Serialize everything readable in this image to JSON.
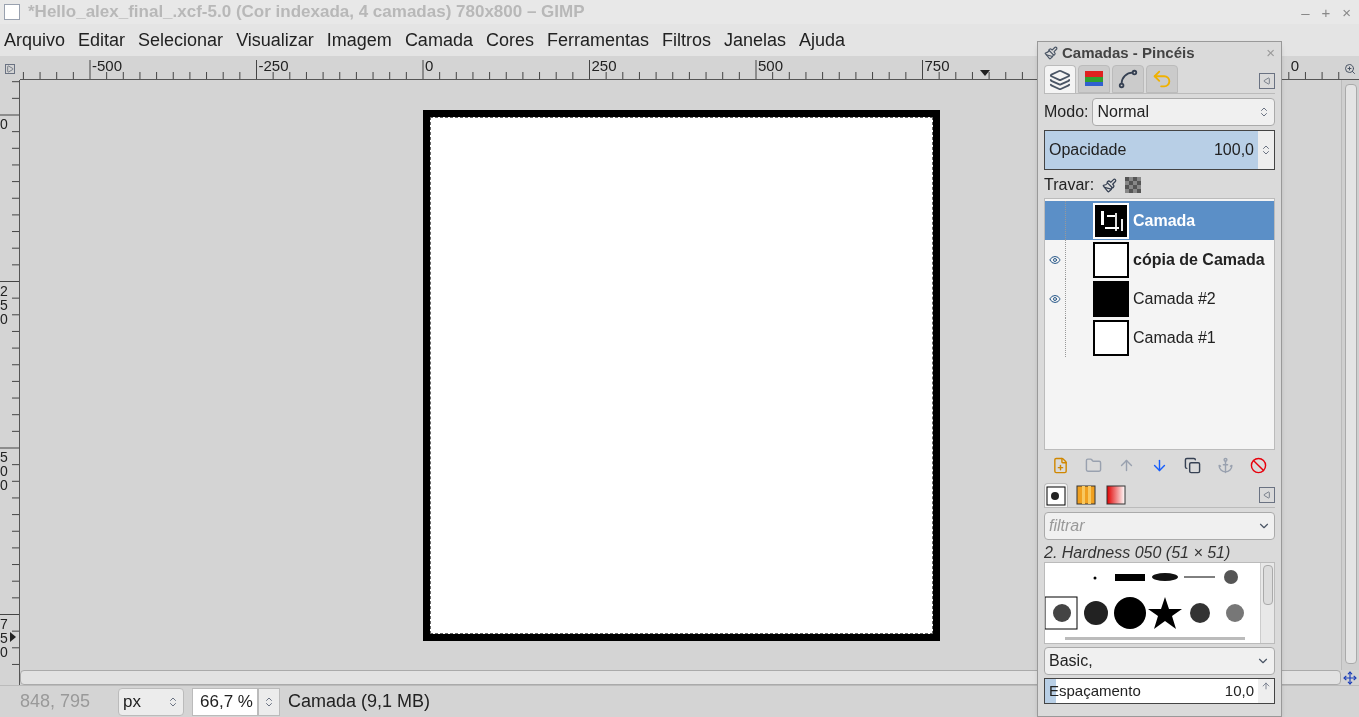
{
  "window": {
    "title": "*Hello_alex_final_.xcf-5.0 (Cor indexada, 4 camadas) 780x800 – GIMP",
    "controls": [
      "–",
      "+",
      "×"
    ]
  },
  "menu": [
    "Arquivo",
    "Editar",
    "Selecionar",
    "Visualizar",
    "Imagem",
    "Camada",
    "Cores",
    "Ferramentas",
    "Filtros",
    "Janelas",
    "Ajuda"
  ],
  "rulers": {
    "horizontal": [
      "-500",
      "-250",
      "0",
      "250",
      "500",
      "750",
      "0"
    ],
    "vertical": [
      "0",
      "250",
      "500",
      "750"
    ]
  },
  "status_bar": {
    "coordinates": "848, 795",
    "unit": "px",
    "zoom": "66,7 %",
    "info": "Camada (9,1 MB)"
  },
  "layers_dock": {
    "title": "Camadas - Pincéis",
    "close": "×",
    "tabs": [
      {
        "selected": true
      },
      {
        "selected": false
      },
      {
        "selected": false
      },
      {
        "selected": false
      }
    ],
    "mode_label": "Modo:",
    "mode": "Normal",
    "opacity": {
      "label": "Opacidade",
      "value": "100,0",
      "level": 1
    },
    "lock_label": "Travar:",
    "layers": [
      {
        "name": "Camada",
        "selected": true,
        "visible": false,
        "bold": true,
        "thumbnail": {
          "kind": "pattern"
        }
      },
      {
        "name": "cópia de Camada",
        "selected": false,
        "visible": true,
        "bold": true,
        "thumbnail": {
          "kind": "white"
        }
      },
      {
        "name": "Camada #2",
        "selected": false,
        "visible": true,
        "bold": false,
        "thumbnail": {
          "kind": "black"
        }
      },
      {
        "name": "Camada #1",
        "selected": false,
        "visible": false,
        "bold": false,
        "thumbnail": {
          "kind": "white"
        }
      }
    ]
  },
  "brushes_dock": {
    "tabs": [
      {
        "selected": true
      },
      {
        "selected": false
      },
      {
        "selected": false
      }
    ],
    "filter_placeholder": "filtrar",
    "brush_name": "2. Hardness 050 (51 × 51)",
    "tag": "Basic,",
    "spacing": {
      "label": "Espaçamento",
      "value": "10,0",
      "level": 0.05
    }
  }
}
